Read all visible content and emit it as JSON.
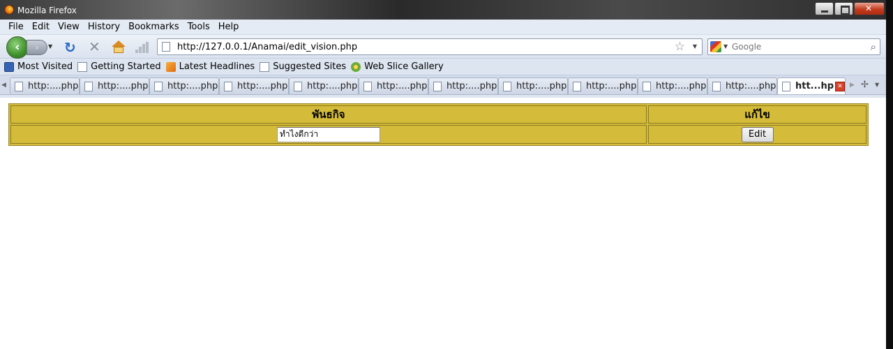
{
  "window": {
    "title": "Mozilla Firefox"
  },
  "menubar": [
    "File",
    "Edit",
    "View",
    "History",
    "Bookmarks",
    "Tools",
    "Help"
  ],
  "navbar": {
    "url": "http://127.0.0.1/Anamai/edit_vision.php",
    "search_placeholder": "Google"
  },
  "bookmarks": [
    {
      "label": "Most Visited",
      "icon": "most-visited-icon"
    },
    {
      "label": "Getting Started",
      "icon": "page-icon"
    },
    {
      "label": "Latest Headlines",
      "icon": "rss-icon"
    },
    {
      "label": "Suggested Sites",
      "icon": "page-icon"
    },
    {
      "label": "Web Slice Gallery",
      "icon": "web-slice-icon"
    }
  ],
  "tabs": [
    {
      "label": "http:....php"
    },
    {
      "label": "http:....php"
    },
    {
      "label": "http:....php"
    },
    {
      "label": "http:....php"
    },
    {
      "label": "http:....php"
    },
    {
      "label": "http:....php"
    },
    {
      "label": "http:....php"
    },
    {
      "label": "http:....php"
    },
    {
      "label": "http:....php"
    },
    {
      "label": "http:....php"
    },
    {
      "label": "http:....php"
    }
  ],
  "active_tab": {
    "label": "htt...hp"
  },
  "table": {
    "headers": [
      "พันธกิจ",
      "แก้ไข"
    ],
    "row": {
      "vision_value": "ทำไงดีกว่า",
      "edit_label": "Edit"
    },
    "color": "#d4bb3a"
  }
}
